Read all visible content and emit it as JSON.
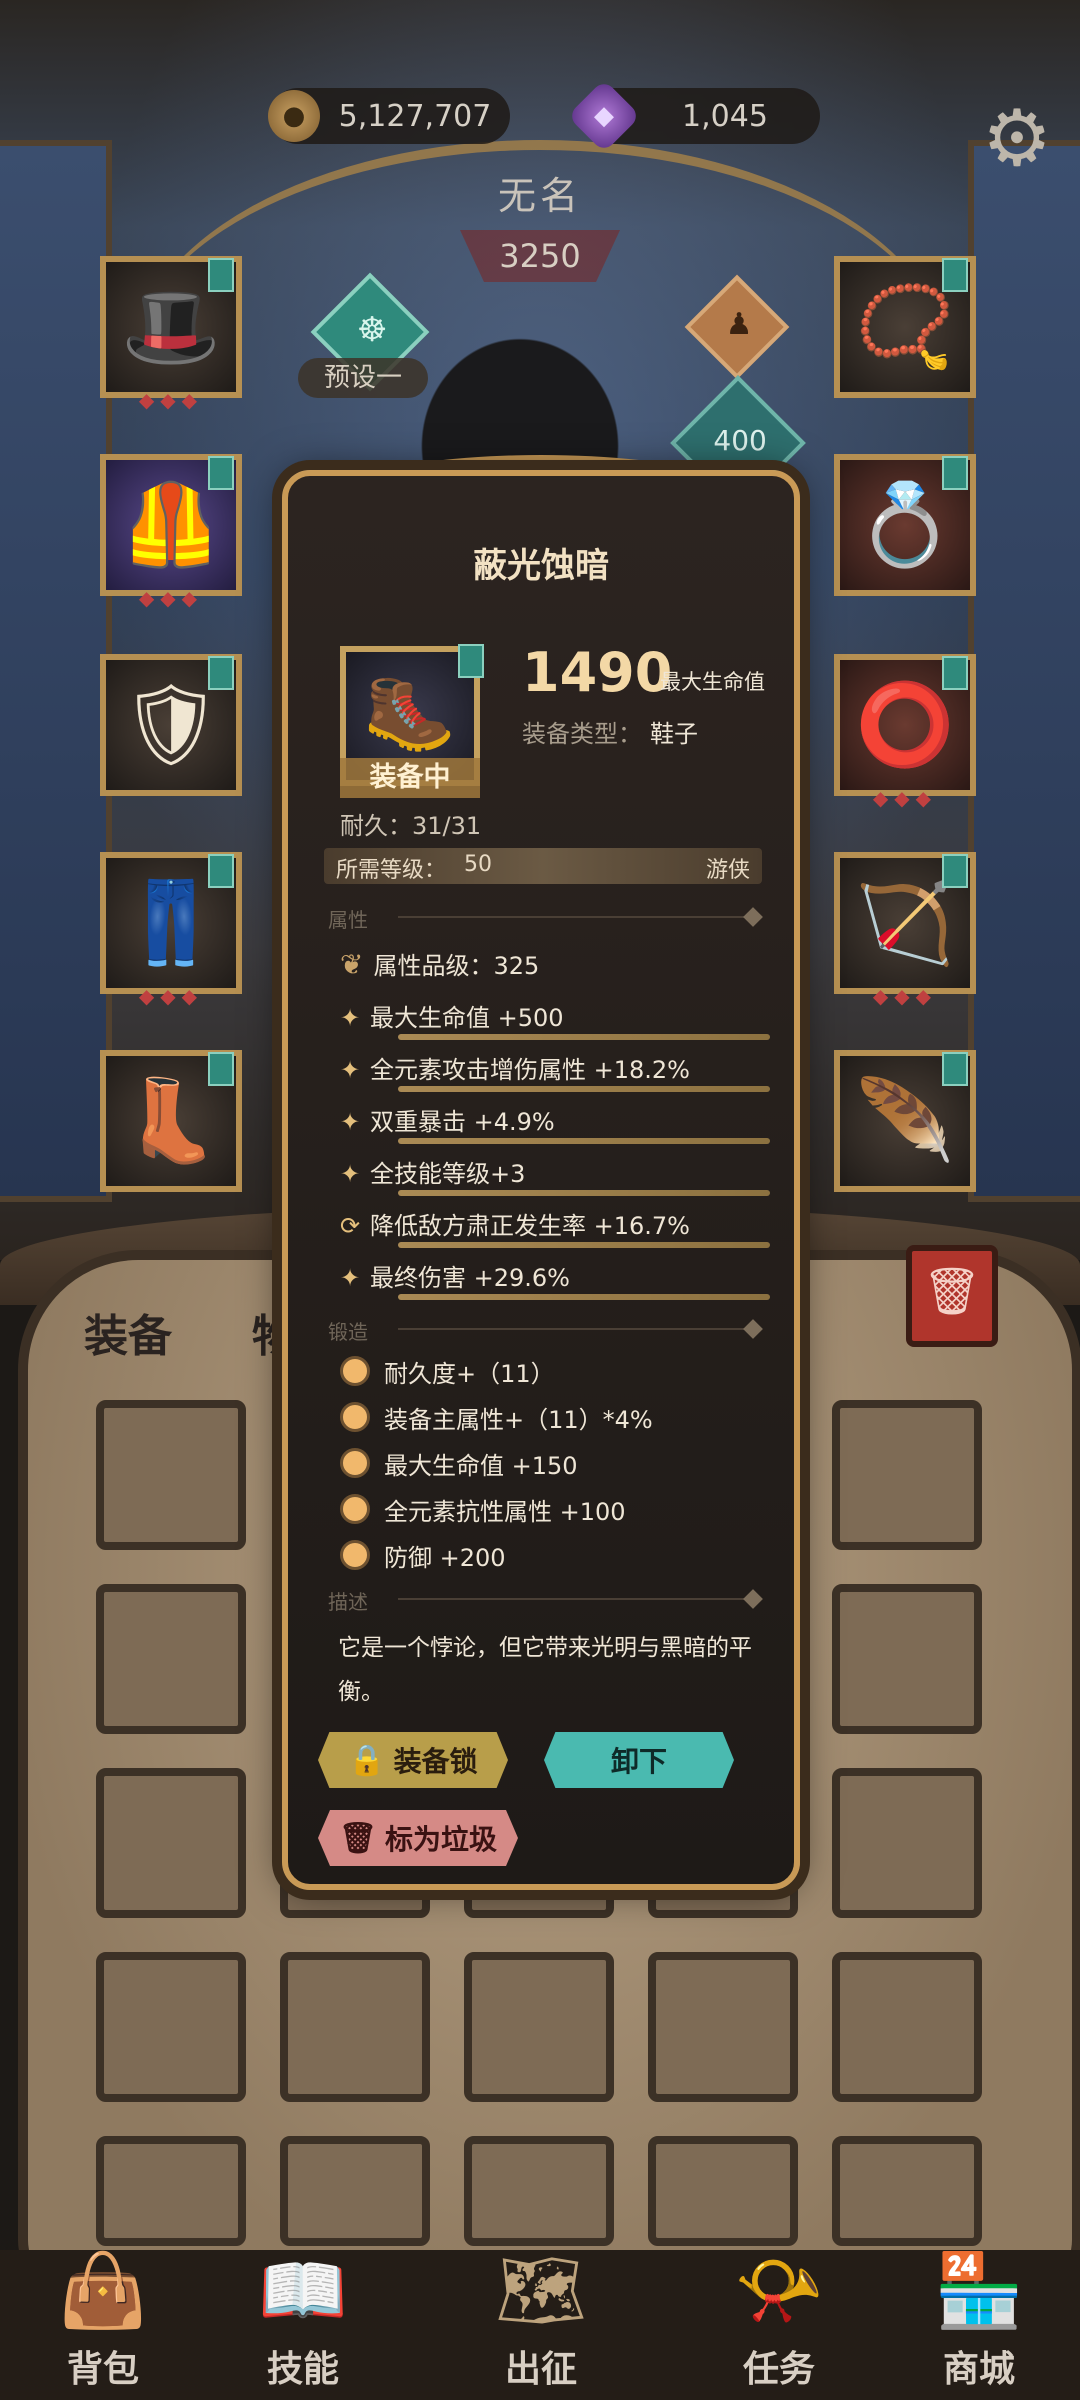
{
  "currency": {
    "gold": "5,127,707",
    "gems": "1,045"
  },
  "hero": {
    "name": "无名",
    "power": "3250",
    "preset": "预设一",
    "pet_level": "400"
  },
  "tabs": {
    "equip": "装备",
    "items": "物品"
  },
  "bottom_nav": [
    "背包",
    "技能",
    "出征",
    "任务",
    "商城"
  ],
  "item": {
    "name": "蔽光蚀暗",
    "main_value": "1490",
    "main_value_label": "最大生命值",
    "type_label": "装备类型：",
    "type_value": "鞋子",
    "equipped": "装备中",
    "durability": "耐久：31/31",
    "required_level_label": "所需等级：",
    "required_level": "50",
    "class": "游侠",
    "attr_header": "属性",
    "quality": "属性品级：325",
    "stats": [
      "最大生命值 +500",
      "全元素攻击增伤属性 +18.2%",
      "双重暴击 +4.9%",
      "全技能等级+3",
      "降低敌方肃正发生率 +16.7%",
      "最终伤害 +29.6%"
    ],
    "forge_header": "锻造",
    "forge": [
      "耐久度+（11）",
      "装备主属性+（11）*4%",
      "最大生命值 +150",
      "全元素抗性属性 +100",
      "防御 +200"
    ],
    "desc_header": "描述",
    "description": "它是一个悖论，但它带来光明与黑暗的平衡。",
    "buttons": {
      "lock": "装备锁",
      "unequip": "卸下",
      "junk": "标为垃圾"
    }
  },
  "icons": {
    "gold": "coin-icon",
    "gem": "gem-icon",
    "settings": "gear-icon",
    "lock": "lock-icon",
    "junk": "trash-icon"
  }
}
